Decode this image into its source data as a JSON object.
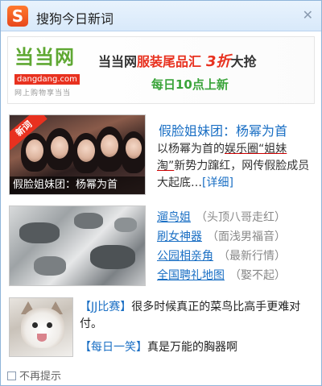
{
  "window": {
    "title": "搜狗今日新词",
    "logo_glyph": "S",
    "close_glyph": "✕"
  },
  "banner": {
    "brand": "当当网",
    "brand_url": "dangdang.com",
    "brand_slogan": "网上购物享当当",
    "headline_part1": "当当网",
    "headline_part2": "服装尾品汇",
    "headline_part3": "3折",
    "headline_part4": "大抢",
    "subline": "每日10点上新",
    "accent_red": "#e8311f",
    "accent_green": "#3aa43a"
  },
  "news1": {
    "ribbon": "新词",
    "image_caption": "假脸姐妹团：杨幂为首",
    "headline": "假脸姐妹团：杨幂为首",
    "desc_part1": "以杨幂为首的",
    "desc_part2": "娱乐圈“姐妹淘”",
    "desc_part3": "新势力蹿红，网传假脸成员大起底…",
    "more": "[详细]"
  },
  "news2": {
    "items": [
      {
        "link": "遛鸟姐",
        "hint": "（头顶八哥走红）"
      },
      {
        "link": "刷女神器",
        "hint": "（面浅男福音）"
      },
      {
        "link": "公园相亲角",
        "hint": "（最新行情）"
      },
      {
        "link": "全国聘礼地图",
        "hint": "（娶不起）"
      }
    ]
  },
  "jokes": [
    {
      "tag": "【JJ比赛】",
      "text": "很多时候真正的菜鸟比高手更难对付。"
    },
    {
      "tag": "【每日一笑】",
      "text": "真是万能的胸器啊"
    }
  ],
  "footer": {
    "checkbox_label": "不再提示"
  }
}
